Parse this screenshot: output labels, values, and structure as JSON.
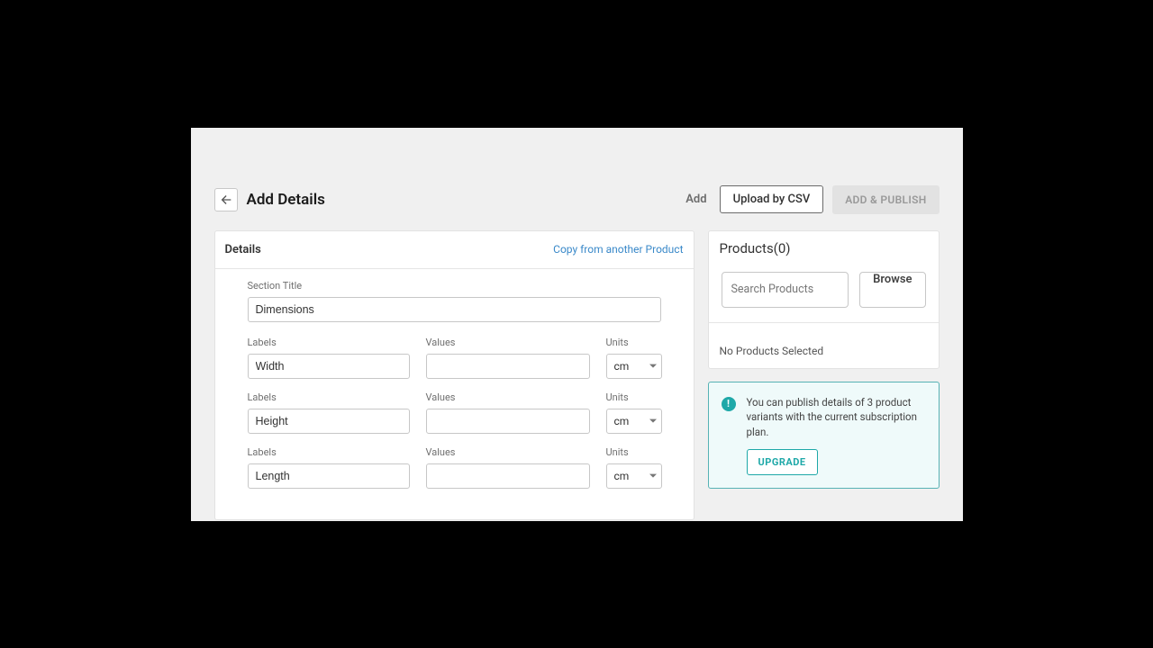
{
  "header": {
    "title": "Add Details",
    "actions": {
      "add": "Add",
      "upload": "Upload by CSV",
      "publish": "ADD & PUBLISH"
    }
  },
  "details": {
    "title": "Details",
    "copy_link": "Copy from another Product",
    "section_title_label": "Section Title",
    "section_title_value": "Dimensions",
    "col_labels": "Labels",
    "col_values": "Values",
    "col_units": "Units",
    "rows": [
      {
        "label": "Width",
        "value": "",
        "unit": "cm"
      },
      {
        "label": "Height",
        "value": "",
        "unit": "cm"
      },
      {
        "label": "Length",
        "value": "",
        "unit": "cm"
      }
    ]
  },
  "products": {
    "title": "Products(0)",
    "search_placeholder": "Search Products",
    "browse": "Browse",
    "empty": "No Products Selected"
  },
  "upgrade": {
    "icon": "!",
    "message": "You can publish details of 3 product variants with the current subscription plan.",
    "button": "UPGRADE"
  }
}
